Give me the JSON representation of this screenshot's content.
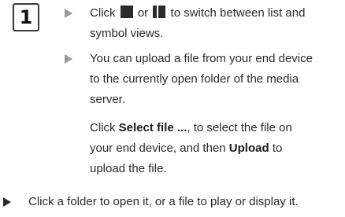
{
  "step_number": "1",
  "item1": {
    "prefix": "Click",
    "or": "or",
    "suffix": "to switch between list and",
    "line2": "symbol views."
  },
  "item2": {
    "line1": "You can upload a file from your end device",
    "line2": "to the currently open folder of the media",
    "line3": "server.",
    "line4_bold": "Select file ...",
    "line4_prefix": "Click",
    "line4_suffix": ", to select the file on",
    "line5_prefix": "your end device, and then",
    "line5_bold": "Upload",
    "line5_suffix": "to",
    "line6": "upload the file."
  },
  "item3": {
    "text": "Click a folder to open it, or a file to play or display it."
  },
  "colors": {
    "text": "#2a2a2a",
    "bullet_light": "#9a9a9a",
    "bullet_dark": "#2a2a2a"
  },
  "icons": [
    "list-view-icon",
    "symbol-view-icon",
    "bullet-arrow-icon"
  ]
}
